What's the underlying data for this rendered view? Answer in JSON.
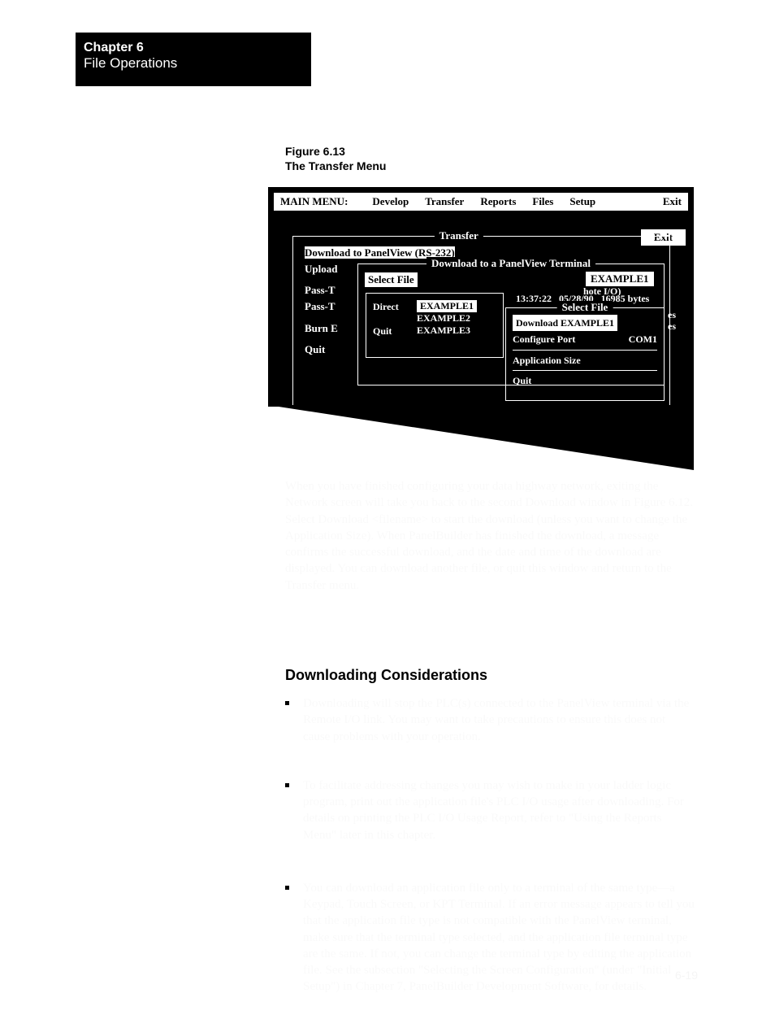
{
  "chapter": {
    "title": "Chapter 6",
    "subtitle": "File Operations"
  },
  "figure_caption": {
    "line1": "Figure 6.13",
    "line2": "The Transfer Menu"
  },
  "menubar": {
    "title": "MAIN MENU:",
    "items": [
      "Develop",
      "Transfer",
      "Reports",
      "Files",
      "Setup",
      "Exit"
    ]
  },
  "exit_button": "Exit",
  "transfer_panel": {
    "title": "Transfer",
    "items": {
      "download": "Download to PanelView (RS-232)",
      "upload": "Upload",
      "passt1": "Pass-T",
      "passt2": "Pass-T",
      "burn": "Burn E",
      "quit": "Quit"
    },
    "remote_io_frag": "hote I/O)",
    "bytes_suffix_1": "es",
    "bytes_suffix_2": "es"
  },
  "download_panel": {
    "title": "Download to a PanelView Terminal",
    "select_file_label": "Select File",
    "selected_file": "EXAMPLE1"
  },
  "select_file_popup": {
    "left": {
      "direct": "Direct",
      "quit": "Quit"
    },
    "files": [
      "EXAMPLE1",
      "EXAMPLE2",
      "EXAMPLE3"
    ]
  },
  "file_info": {
    "timestamp": "13:37:22",
    "date": "05/28/90",
    "size": "16985 bytes",
    "panel_title": "Select File",
    "download_line": "Download EXAMPLE1",
    "configure_port": "Configure Port",
    "port_value": "COM1",
    "app_size": "Application Size",
    "quit": "Quit"
  },
  "intro_text": "When you have finished configuring your data highway network, exiting the Network screen will take you back to the second Download window in Figure 6.12. Select Download <filename> to start the download (unless you want to change the Application Size). When PanelBuilder has finished the download, a message confirms the successful download, and the date and time of the download are displayed. You can download another file, or quit this window and return to the Transfer menu.",
  "section_heading": "Downloading Considerations",
  "bullets": [
    "Downloading will stop the PLC(s) connected to the PanelView terminal via the Remote I/O link. You may want to take precautions to ensure this does not cause problems with your operation.",
    "To facilitate addressing changes you may wish to make in your ladder logic program, print out the application file's PLC I/O usage after downloading. For details on printing the PLC I/O Usage Report, refer to \"Using the Reports Menu\" later in this chapter.",
    "You can download an application file only to a terminal of the same type—a Keypad, Touch Screen, or KPT Terminal. If an error message appears to tell you that the application file type is not compatible with the PanelView terminal, make sure that the terminal type selected, and the application file terminal type are the same. If not, you can change the terminal type by editing the application file. See the subsection \"Selecting the Screen Configuration\" (under \"Initial Setup\") in Chapter 7, PanelBuilder Development Software, for details."
  ],
  "page_number": "6-19"
}
